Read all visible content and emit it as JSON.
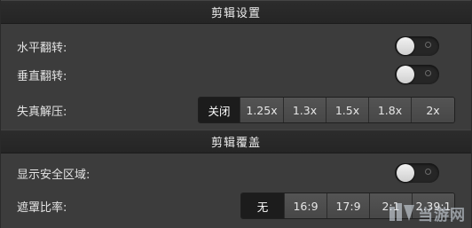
{
  "clip_settings": {
    "title": "剪辑设置",
    "rows": [
      {
        "label": "水平翻转:",
        "toggle_on": false
      },
      {
        "label": "垂直翻转:",
        "toggle_on": false
      }
    ],
    "distortion": {
      "label": "失真解压:",
      "options": [
        "关闭",
        "1.25x",
        "1.3x",
        "1.5x",
        "1.8x",
        "2x"
      ],
      "selected": "关闭"
    }
  },
  "clip_overlay": {
    "title": "剪辑覆盖",
    "safe_area": {
      "label": "显示安全区域:",
      "toggle_on": false
    },
    "mask_ratio": {
      "label": "遮罩比率:",
      "options": [
        "无",
        "16:9",
        "17:9",
        "2:1",
        "2.39:1"
      ],
      "selected": "无"
    }
  },
  "watermark": {
    "text": "当游网",
    "icon": "download-logo-icon"
  },
  "colors": {
    "panel_bg": "#3c3c3c",
    "header_bg": "#262626",
    "segment_bg": "#4d4d4d",
    "segment_selected_bg": "#1c1c1c",
    "toggle_knob": "#e6e6e6"
  }
}
